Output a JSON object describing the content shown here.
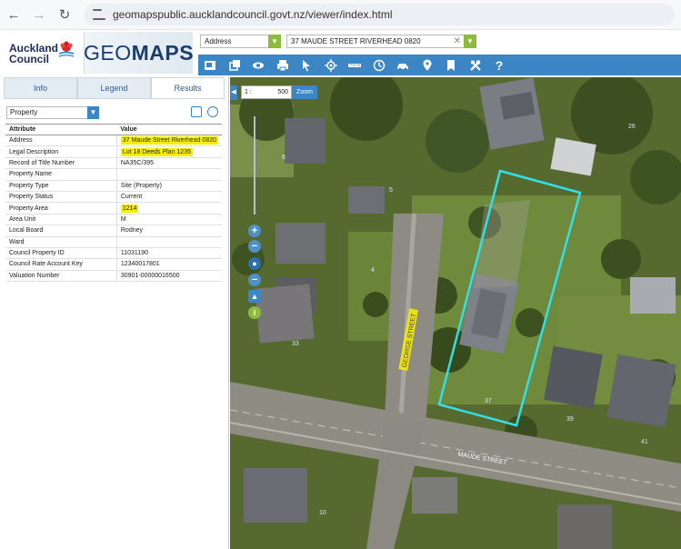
{
  "browser": {
    "url": "geomapspublic.aucklandcouncil.govt.nz/viewer/index.html",
    "back_icon": "arrow-left-icon",
    "forward_icon": "arrow-right-icon",
    "reload_icon": "reload-icon"
  },
  "header": {
    "council_line1": "Auckland",
    "council_line2": "Council",
    "app_name_bold": "GEO",
    "app_name_rest": "MAPS",
    "search_type": "Address",
    "search_value": "37 MAUDE STREET RIVERHEAD 0820"
  },
  "toolbar": {
    "tools": [
      "print-map-icon",
      "layers-icon",
      "view-icon",
      "printer-icon",
      "pointer-icon",
      "locate-icon",
      "measure-icon",
      "history-icon",
      "drive-icon",
      "place-marker-icon",
      "bookmark-icon",
      "tools-icon",
      "help-icon"
    ],
    "help_label": "?"
  },
  "panel": {
    "tabs": [
      "Info",
      "Legend",
      "Results"
    ],
    "active_tab": "Results",
    "layer_select": "Property",
    "table": {
      "headers": [
        "Attribute",
        "Value"
      ],
      "rows": [
        {
          "attr": "Address",
          "value": "37 Maude Street Riverhead 0820",
          "highlight": true
        },
        {
          "attr": "Legal Description",
          "value": "Lot 18 Deeds Plan 1235",
          "highlight": true
        },
        {
          "attr": "Record of Title Number",
          "value": "NA35C/395",
          "highlight": false
        },
        {
          "attr": "Property Name",
          "value": "",
          "highlight": false
        },
        {
          "attr": "Property Type",
          "value": "Site (Property)",
          "highlight": false
        },
        {
          "attr": "Property Status",
          "value": "Current",
          "highlight": false
        },
        {
          "attr": "Property Area",
          "value": "1214",
          "highlight": true
        },
        {
          "attr": "Area Unit",
          "value": "M",
          "highlight": false
        },
        {
          "attr": "Local Board",
          "value": "Rodney",
          "highlight": false
        },
        {
          "attr": "Ward",
          "value": "",
          "highlight": false
        },
        {
          "attr": "Council Property ID",
          "value": "11031190",
          "highlight": false
        },
        {
          "attr": "Council Rate Account Key",
          "value": "12340017801",
          "highlight": false
        },
        {
          "attr": "Valuation Number",
          "value": "30901-00000016500",
          "highlight": false
        }
      ]
    }
  },
  "map": {
    "scale_prefix": "1 :",
    "scale_value": "500",
    "zoom_label": "Zoom",
    "street_label_1": "MAUDE STREET",
    "street_label_2": "GEORGE STREET",
    "parcel_numbers": [
      "37",
      "39",
      "33",
      "4",
      "5",
      "6",
      "10",
      "41",
      "26"
    ],
    "highlight_color": "#31e0e8",
    "accent_color": "#3d86c6",
    "highlight_yellow": "#f7ee00"
  }
}
